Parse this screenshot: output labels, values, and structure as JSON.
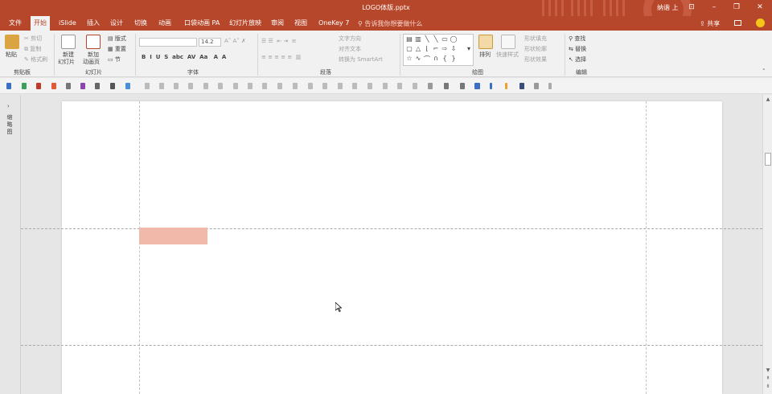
{
  "window": {
    "title": "LOGO体版.pptx",
    "user": "纳谐 上"
  },
  "menu": {
    "tabs": [
      "文件",
      "开始",
      "iSlide",
      "插入",
      "设计",
      "切换",
      "动画",
      "口袋动画 PA",
      "幻灯片放映",
      "审阅",
      "视图",
      "OneKey 7"
    ],
    "active_tab": "开始",
    "tell_me": "告诉我你想要做什么",
    "share": "共享"
  },
  "ribbon": {
    "clipboard": {
      "paste": "粘贴",
      "cut": "剪切",
      "copy": "复制",
      "format_painter": "格式刷",
      "label": "剪贴板"
    },
    "slides": {
      "new_slide_1": "新建",
      "new_slide_2": "幻灯片",
      "new_anim_1": "新加",
      "new_anim_2": "动画页",
      "layout": "版式",
      "reset": "重置",
      "section": "节",
      "label": "幻灯片"
    },
    "font": {
      "font_size": "14.2",
      "label": "字体"
    },
    "paragraph": {
      "text_direction": "文字方向",
      "align_text": "对齐文本",
      "smartart": "转换为 SmartArt",
      "label": "段落"
    },
    "drawing": {
      "arrange": "排列",
      "quick_styles": "快速样式",
      "shape_fill": "形状填充",
      "shape_outline": "形状轮廓",
      "shape_effects": "形状效果",
      "label": "绘图"
    },
    "editing": {
      "find": "查找",
      "replace": "替换",
      "select": "选择",
      "label": "编辑"
    }
  },
  "thumbnails_label": "缩略图",
  "colors": {
    "accent": "#b7472a",
    "highlight_rect": "#f1b9aa"
  },
  "icons": [
    "paste-icon",
    "cut-icon",
    "copy-icon",
    "format-painter-icon",
    "find-icon",
    "replace-icon",
    "select-icon",
    "share-icon",
    "comment-icon",
    "smiley-icon",
    "mouse-cursor-icon"
  ]
}
